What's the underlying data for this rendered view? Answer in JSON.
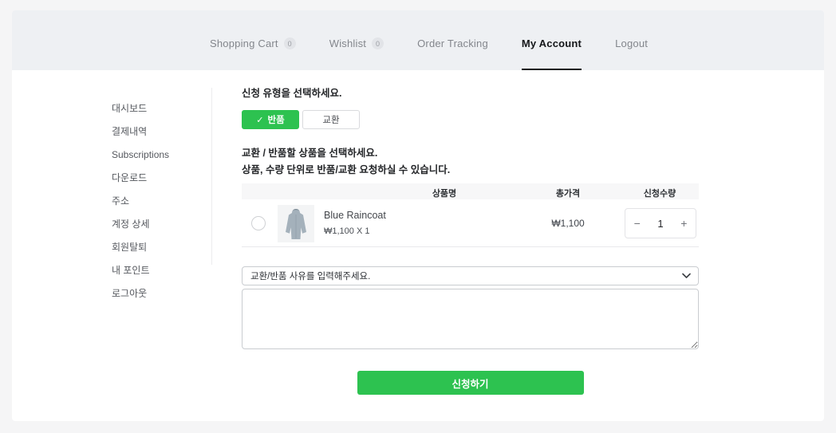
{
  "colors": {
    "accent_green": "#2dc250",
    "band_gray": "#eef0f3"
  },
  "nav": {
    "items": [
      {
        "label": "Shopping Cart",
        "badge": "0",
        "active": false
      },
      {
        "label": "Wishlist",
        "badge": "0",
        "active": false
      },
      {
        "label": "Order Tracking",
        "active": false
      },
      {
        "label": "My Account",
        "active": true
      },
      {
        "label": "Logout",
        "active": false
      }
    ]
  },
  "sidebar": {
    "items": [
      {
        "label": "대시보드"
      },
      {
        "label": "결제내역"
      },
      {
        "label": "Subscriptions"
      },
      {
        "label": "다운로드"
      },
      {
        "label": "주소"
      },
      {
        "label": "계정 상세"
      },
      {
        "label": "회원탈퇴"
      },
      {
        "label": "내 포인트"
      },
      {
        "label": "로그아웃"
      }
    ]
  },
  "main": {
    "type_prompt": "신청 유형을 선택하세요.",
    "type_buttons": {
      "return_check": "✓",
      "return_label": "반품",
      "exchange_label": "교환"
    },
    "select_prompt": "교환 / 반품할 상품을 선택하세요.",
    "select_hint": "상품, 수량 단위로 반품/교환 요청하실 수 있습니다.",
    "table": {
      "headers": [
        "상품명",
        "총가격",
        "신청수량"
      ],
      "rows": [
        {
          "name": "Blue Raincoat",
          "unit_price": "₩1,100 X 1",
          "total": "₩1,100",
          "qty": "1"
        }
      ]
    },
    "stepper": {
      "minus": "−",
      "plus": "+"
    },
    "reason_placeholder": "교환/반품 사유를 입력해주세요.",
    "submit_label": "신청하기"
  }
}
